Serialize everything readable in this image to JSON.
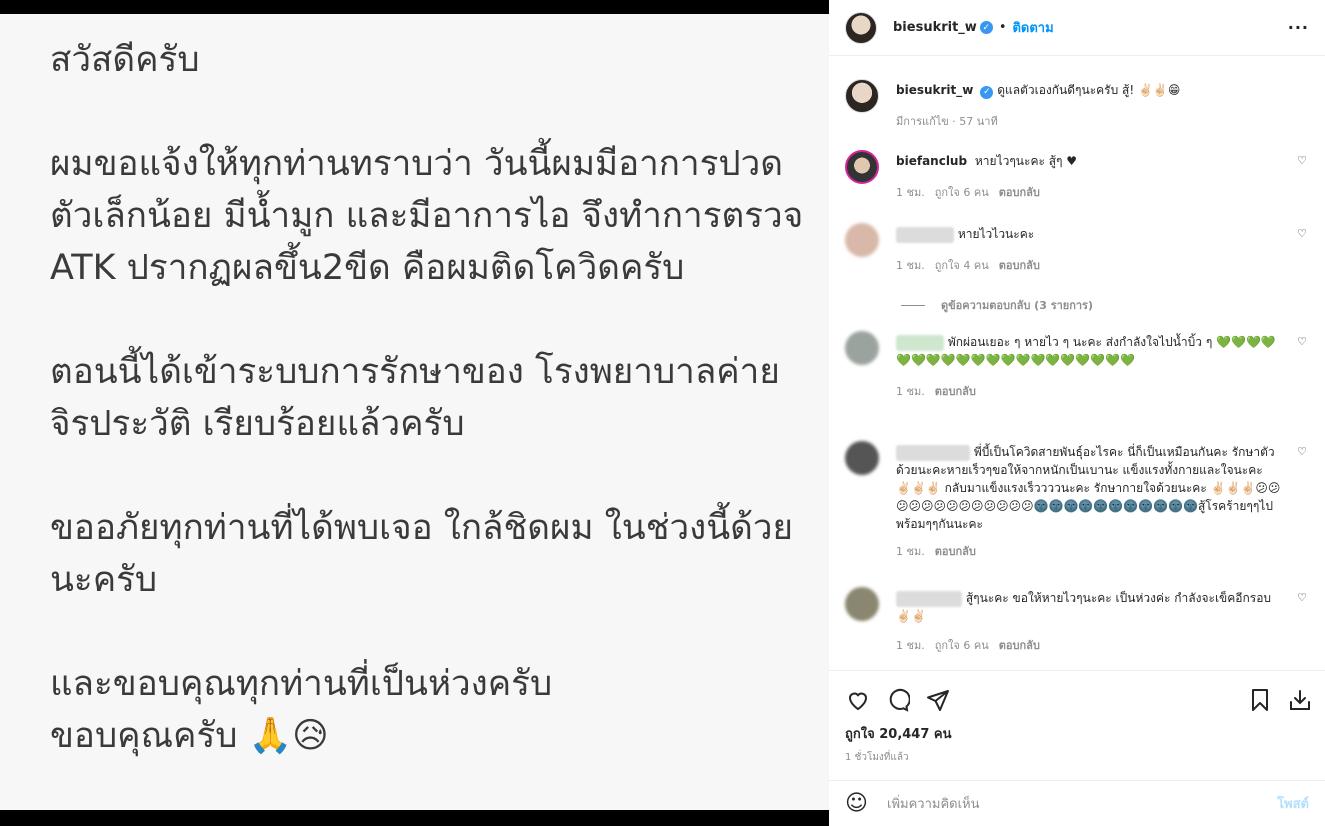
{
  "post_image": {
    "lines": [
      "สวัสดีครับ",
      "",
      "ผมขอแจ้งให้ทุกท่านทราบว่า วันนี้ผมมีอาการปวด",
      "ตัวเล็กน้อย มีน้ำมูก และมีอาการไอ จึงทำการตรวจ",
      "ATK ปรากฏผลขึ้น2ขีด คือผมติดโควิดครับ",
      "",
      "ตอนนี้ได้เข้าระบบการรักษาของ โรงพยาบาลค่าย",
      "จิรประวัติ เรียบร้อยแล้วครับ",
      "",
      "ขออภัยทุกท่านที่ได้พบเจอ ใกล้ชิดผม ในช่วงนี้ด้วย",
      "นะครับ",
      "",
      "และขอบคุณทุกท่านที่เป็นห่วงครับ",
      "ขอบคุณครับ 🙏😥"
    ]
  },
  "header": {
    "username": "biesukrit_w",
    "dot": "•",
    "follow": "ติดตาม",
    "more": "···"
  },
  "caption": {
    "username": "biesukrit_w",
    "text": "ดูแลตัวเองกันดีๆนะครับ สู้! ✌🏻✌🏻😁",
    "meta": "มีการแก้ไข · 57 นาที"
  },
  "comments": [
    {
      "username": "biefanclub",
      "text": "หายไวๆนะคะ สู้ๆ ♥",
      "time": "1 ชม.",
      "likes": "ถูกใจ 6 คน",
      "reply": "ตอบกลับ"
    },
    {
      "username": "",
      "text": "หายไวไวนะคะ",
      "time": "1 ชม.",
      "likes": "ถูกใจ 4 คน",
      "reply": "ตอบกลับ"
    },
    {
      "username": "",
      "text": "พักผ่อนเยอะ ๆ หายไว ๆ นะคะ ส่งกำลังใจไปน้ำบิ้ว ๆ 💚💚💚💚💚💚💚💚💚💚💚💚💚💚💚💚💚💚💚💚",
      "time": "1 ชม.",
      "likes": "",
      "reply": "ตอบกลับ"
    },
    {
      "username": "",
      "text": "พี่บี้เป็นโควิดสายพันธุ์อะไรคะ นี่ก็เป็นเหมือนกันคะ รักษาตัวด้วยนะคะหายเร็วๆขอให้จากหนักเป็นเบานะ แข็งแรงทั้งกายและใจนะคะ ✌🏻✌🏻✌🏻 กลับมาแข็งแรงเร็ววววนะคะ รักษากายใจด้วยนะคะ ✌🏻✌🏻✌🏻😕😕😕😕😕😕😕😕😕😕😕😕😕🌚🌚🌚🌚🌚🌚🌚🌚🌚🌚🌚สู้โรคร้ายๆๆไปพร้อมๆๆกันนะคะ",
      "time": "1 ชม.",
      "likes": "",
      "reply": "ตอบกลับ"
    },
    {
      "username": "",
      "text": "สู้ๆนะคะ ขอให้หายไวๆนะคะ เป็นห่วงค่ะ กำลังจะเข็คอีกรอบ✌🏻✌🏻",
      "time": "1 ชม.",
      "likes": "ถูกใจ 6 คน",
      "reply": "ตอบกลับ"
    }
  ],
  "view_replies": "ดูข้อความตอบกลับ (3 รายการ)",
  "actions": {
    "likes": "ถูกใจ 20,447 คน",
    "time": "1 ชั่วโมงที่แล้ว"
  },
  "composer": {
    "placeholder": "เพิ่มความคิดเห็น",
    "post": "โพสต์"
  },
  "colors": {
    "accent": "#0095f6",
    "verified": "#3897f0",
    "muted": "#8e8e8e"
  }
}
